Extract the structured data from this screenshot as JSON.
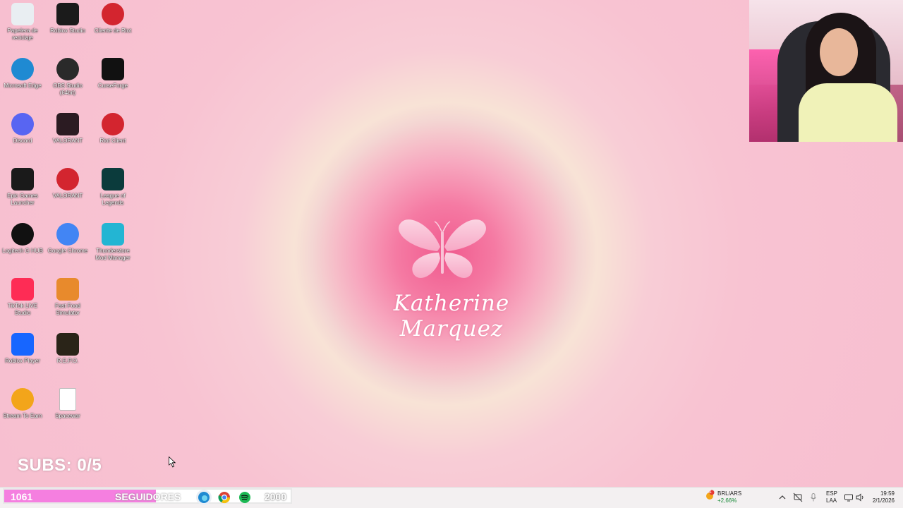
{
  "wallpaper": {
    "name": "Katherine Marquez"
  },
  "desktop_icons": [
    {
      "label": "Papelera de reciclaje",
      "icon": "recycle-bin-icon",
      "color": "#e9eef2"
    },
    {
      "label": "Roblox Studio",
      "icon": "roblox-studio-icon",
      "color": "#1b1b1b"
    },
    {
      "label": "Cliente de Riot",
      "icon": "riot-client-icon",
      "color": "#d3252f"
    },
    {
      "label": "Microsoft Edge",
      "icon": "edge-icon",
      "color": "#1f8ad2"
    },
    {
      "label": "OBS Studio (64bit)",
      "icon": "obs-icon",
      "color": "#2a2a2a"
    },
    {
      "label": "CurseForge",
      "icon": "curseforge-icon",
      "color": "#111111"
    },
    {
      "label": "Discord",
      "icon": "discord-icon",
      "color": "#5865f2"
    },
    {
      "label": "VALORANT",
      "icon": "valorant-icon",
      "color": "#2b1b22"
    },
    {
      "label": "Riot Client",
      "icon": "riot-client-icon",
      "color": "#d3252f"
    },
    {
      "label": "Epic Games Launcher",
      "icon": "epic-games-icon",
      "color": "#1a1a1a"
    },
    {
      "label": "VALORANT",
      "icon": "riot-valorant-icon",
      "color": "#d3252f"
    },
    {
      "label": "League of Legends",
      "icon": "league-of-legends-icon",
      "color": "#0b3b3c"
    },
    {
      "label": "Logitech G HUB",
      "icon": "logitech-ghub-icon",
      "color": "#111111"
    },
    {
      "label": "Google Chrome",
      "icon": "chrome-icon",
      "color": "#4285f4"
    },
    {
      "label": "Thunderstore Mod Manager",
      "icon": "thunderstore-icon",
      "color": "#23b5d3"
    },
    {
      "label": "TikTok LIVE Studio",
      "icon": "tiktok-live-icon",
      "color": "#fe2c55"
    },
    {
      "label": "Fast Food Simulator",
      "icon": "fast-food-simulator-icon",
      "color": "#e88a2c"
    },
    {
      "label": "Roblox Player",
      "icon": "roblox-player-icon",
      "color": "#1766ff"
    },
    {
      "label": "R.E.P.O.",
      "icon": "repo-icon",
      "color": "#2a2418"
    },
    {
      "label": "Stream To Earn",
      "icon": "stream-to-earn-icon",
      "color": "#f3a51a"
    },
    {
      "label": "Spacewar",
      "icon": "file-icon",
      "color": "#ffffff"
    }
  ],
  "overlay": {
    "subs_text": "SUBS: 0/5",
    "followers_count": "1061",
    "followers_label": "SEGUIDORES",
    "followers_goal": "2000",
    "followers_progress": 0.53
  },
  "taskbar": {
    "apps": [
      {
        "icon": "edge-icon",
        "color": "#1f8ad2"
      },
      {
        "icon": "chrome-icon",
        "color": "#4285f4"
      },
      {
        "icon": "spotify-icon",
        "color": "#1db954"
      },
      {
        "icon": "riot-client-icon",
        "color": "#d3252f"
      }
    ],
    "ticker_name": "BRL/ARS",
    "ticker_change": "+2,66%",
    "ticker_badge": "1",
    "lang_line1": "ESP",
    "lang_line2": "LAA",
    "time": "19:59",
    "date": "2/1/2026"
  }
}
